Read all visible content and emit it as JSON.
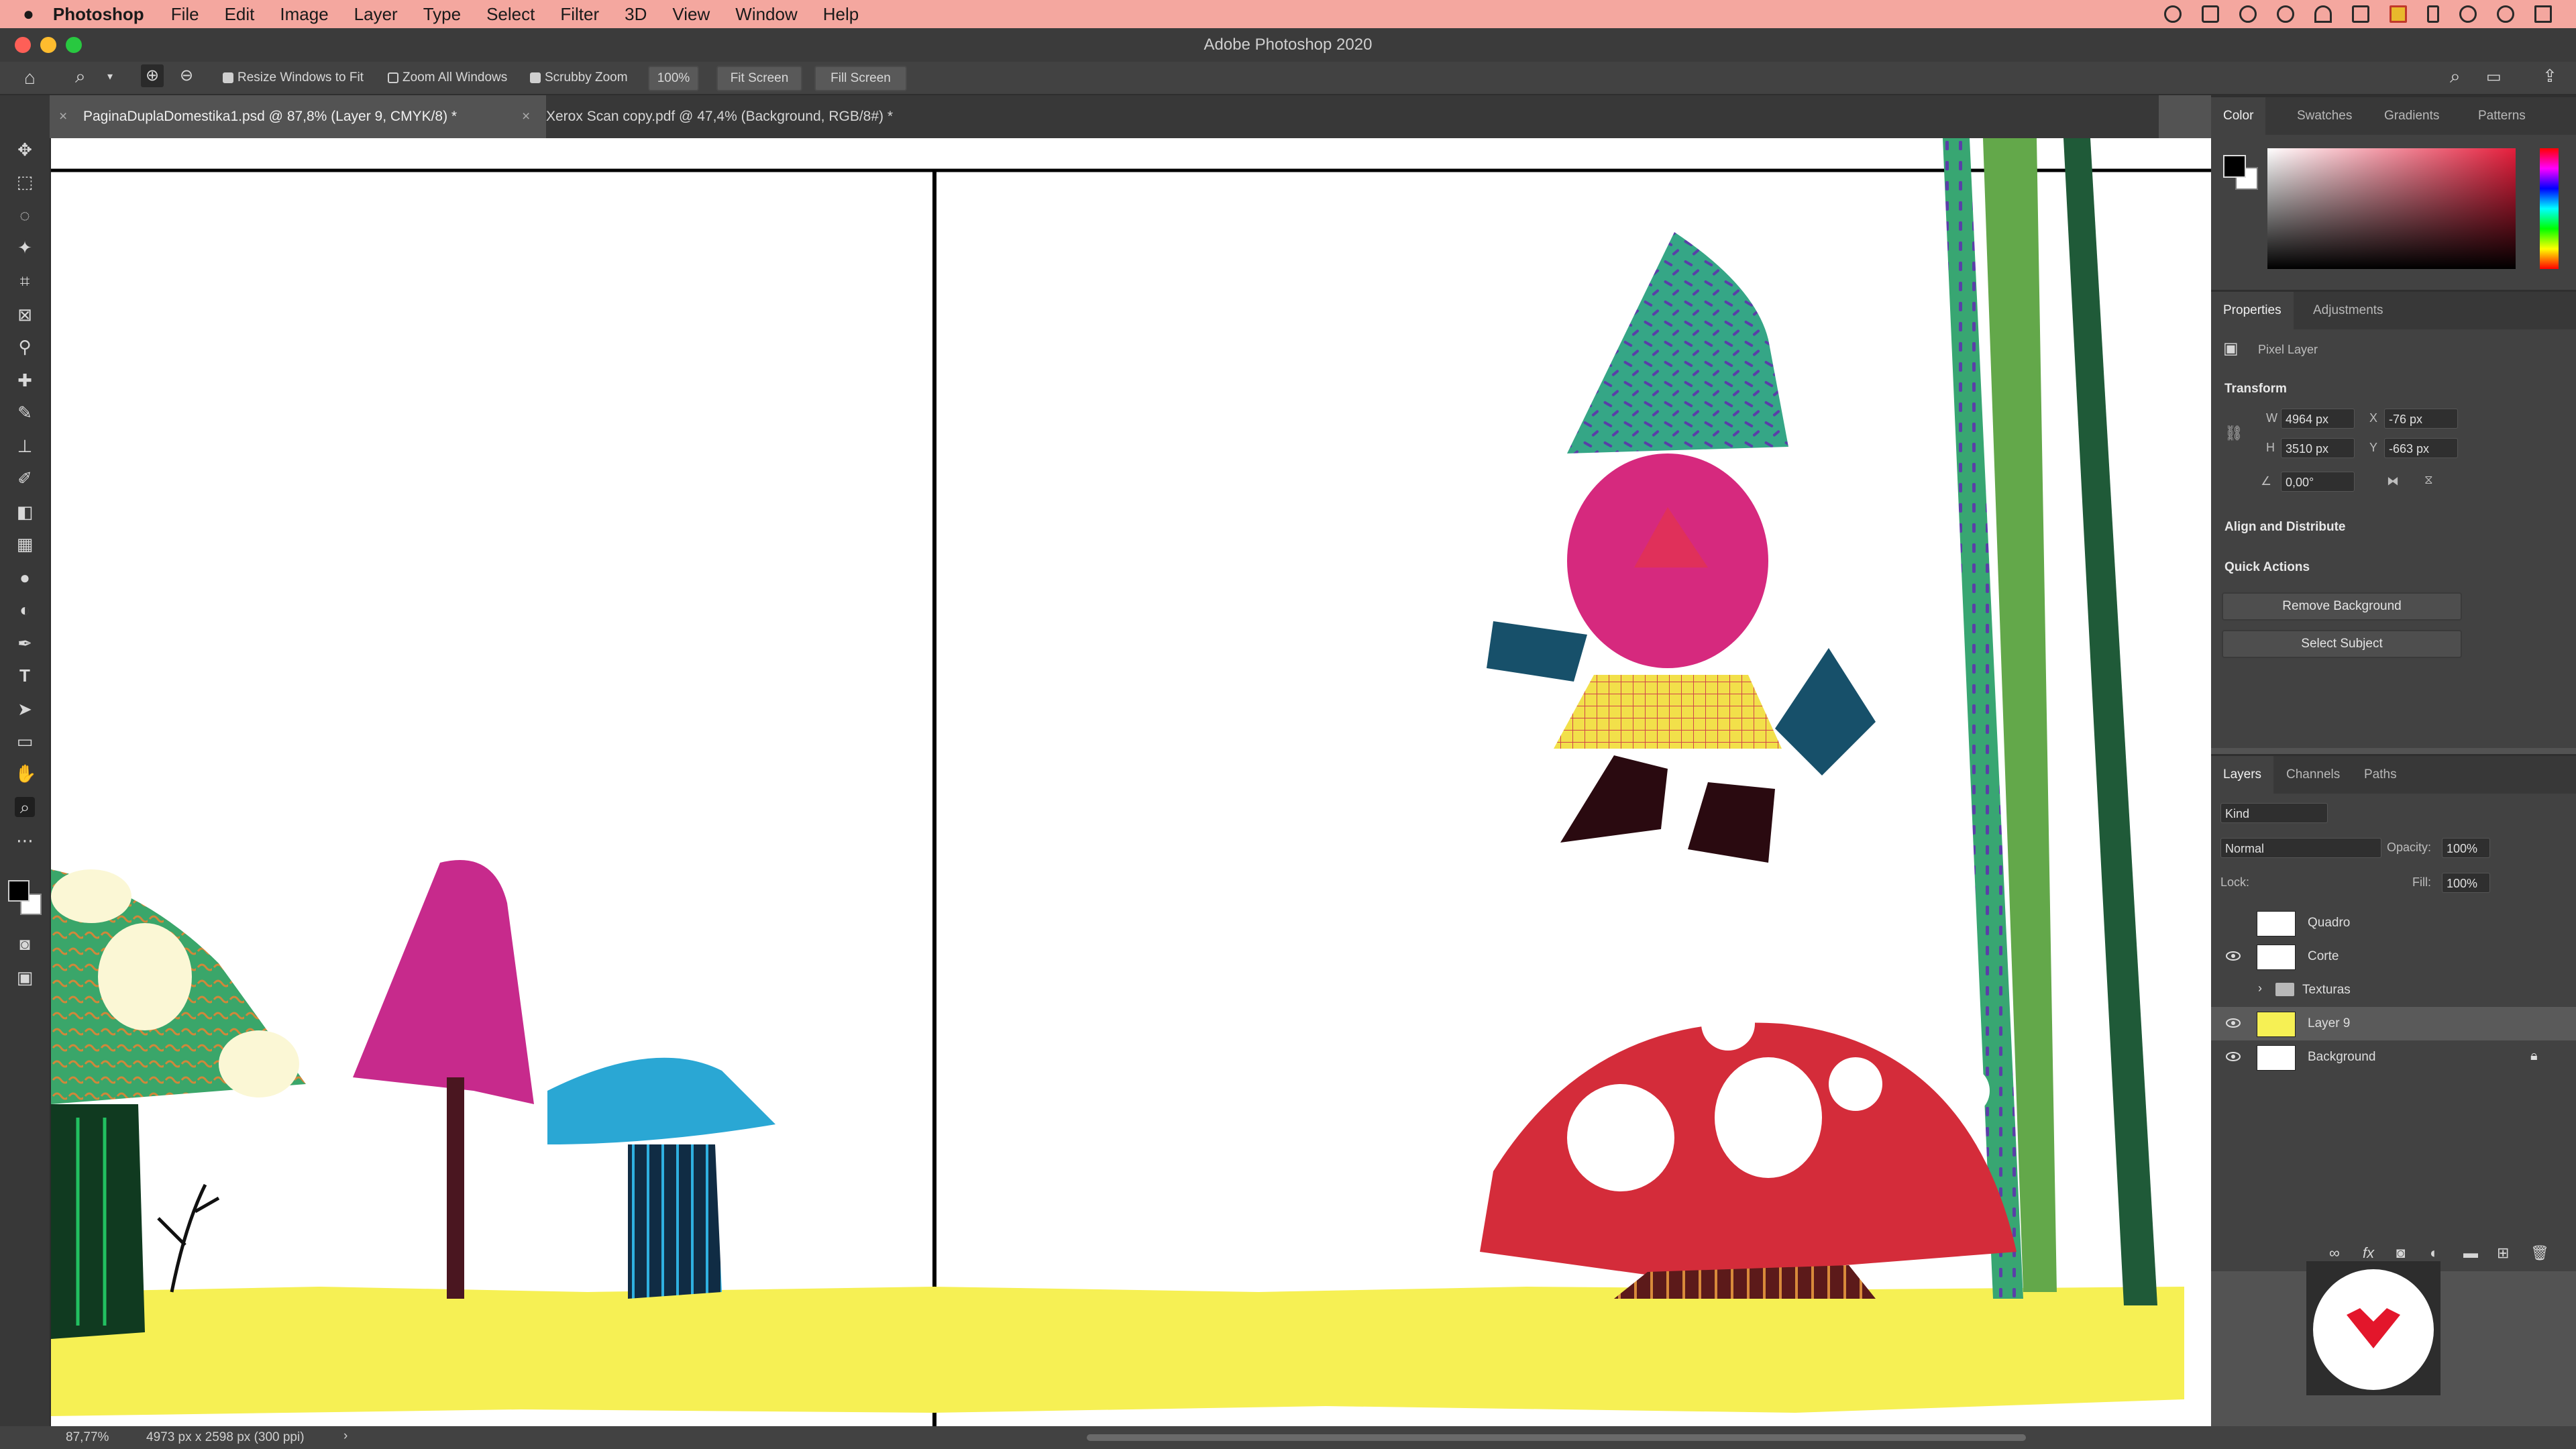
{
  "menubar": {
    "app": "Photoshop",
    "items": [
      "File",
      "Edit",
      "Image",
      "Layer",
      "Type",
      "Select",
      "Filter",
      "3D",
      "View",
      "Window",
      "Help"
    ]
  },
  "window": {
    "title": "Adobe Photoshop 2020"
  },
  "options": {
    "resize_windows": "Resize Windows to Fit",
    "zoom_all": "Zoom All Windows",
    "scrubby": "Scrubby Zoom",
    "zoom_value": "100%",
    "fit_screen": "Fit Screen",
    "fill_screen": "Fill Screen"
  },
  "doc_tabs": [
    {
      "label": "PaginaDuplaDomestika1.psd @ 87,8% (Layer 9, CMYK/8) *"
    },
    {
      "label": "Xerox Scan copy.pdf @ 47,4% (Background, RGB/8#) *"
    }
  ],
  "color_panel": {
    "tabs": [
      "Color",
      "Swatches",
      "Gradients",
      "Patterns"
    ],
    "hue_color": "#e61e3c"
  },
  "properties": {
    "tabs": [
      "Properties",
      "Adjustments"
    ],
    "layer_type": "Pixel Layer",
    "transform_title": "Transform",
    "w_label": "W",
    "w_value": "4964 px",
    "h_label": "H",
    "h_value": "3510 px",
    "x_label": "X",
    "x_value": "-76 px",
    "y_label": "Y",
    "y_value": "-663 px",
    "angle_value": "0,00°",
    "align_title": "Align and Distribute",
    "quick_actions_title": "Quick Actions",
    "remove_bg": "Remove Background",
    "select_subject": "Select Subject"
  },
  "layers": {
    "tabs": [
      "Layers",
      "Channels",
      "Paths"
    ],
    "kind": "Kind",
    "blend": "Normal",
    "opacity_label": "Opacity:",
    "opacity": "100%",
    "lock_label": "Lock:",
    "fill_label": "Fill:",
    "fill": "100%",
    "items": [
      {
        "name": "Quadro"
      },
      {
        "name": "Corte"
      },
      {
        "name": "Texturas"
      },
      {
        "name": "Layer 9"
      },
      {
        "name": "Background"
      }
    ]
  },
  "status": {
    "zoom": "87,77%",
    "doc_info": "4973 px x 2598 px (300 ppi)"
  }
}
